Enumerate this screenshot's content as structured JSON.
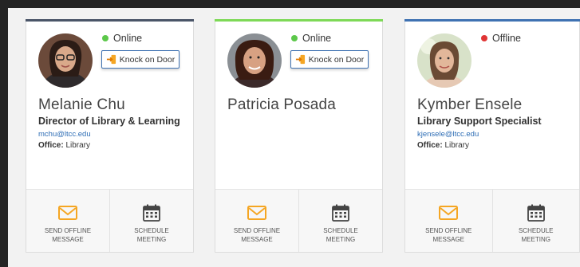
{
  "colors": {
    "online": "#5cc84a",
    "offline": "#e03535",
    "accent_blue": "#3f72b2",
    "mail_orange": "#f5a623"
  },
  "cards": [
    {
      "topbar_color": "#4a5568",
      "status_label": "Online",
      "status_color": "#5cc84a",
      "knock_label": "Knock on Door",
      "name": "Melanie Chu",
      "title": "Director of Library & Learning",
      "email": "mchu@ltcc.edu",
      "office_label": "Office:",
      "office_value": " Library",
      "offline_label": "Send Offline Message",
      "meeting_label": "Schedule Meeting"
    },
    {
      "topbar_color": "#7ed957",
      "status_label": "Online",
      "status_color": "#5cc84a",
      "knock_label": "Knock on Door",
      "name": "Patricia Posada",
      "title": "",
      "email": "",
      "office_label": "",
      "office_value": "",
      "offline_label": "Send Offline Message",
      "meeting_label": "Schedule Meeting"
    },
    {
      "topbar_color": "#3f72b2",
      "status_label": "Offline",
      "status_color": "#e03535",
      "name": "Kymber Ensele",
      "title": "Library Support Specialist",
      "email": "kjensele@ltcc.edu",
      "office_label": "Office:",
      "office_value": " Library",
      "offline_label": "Send Offline Message",
      "meeting_label": "Schedule Meeting"
    }
  ]
}
